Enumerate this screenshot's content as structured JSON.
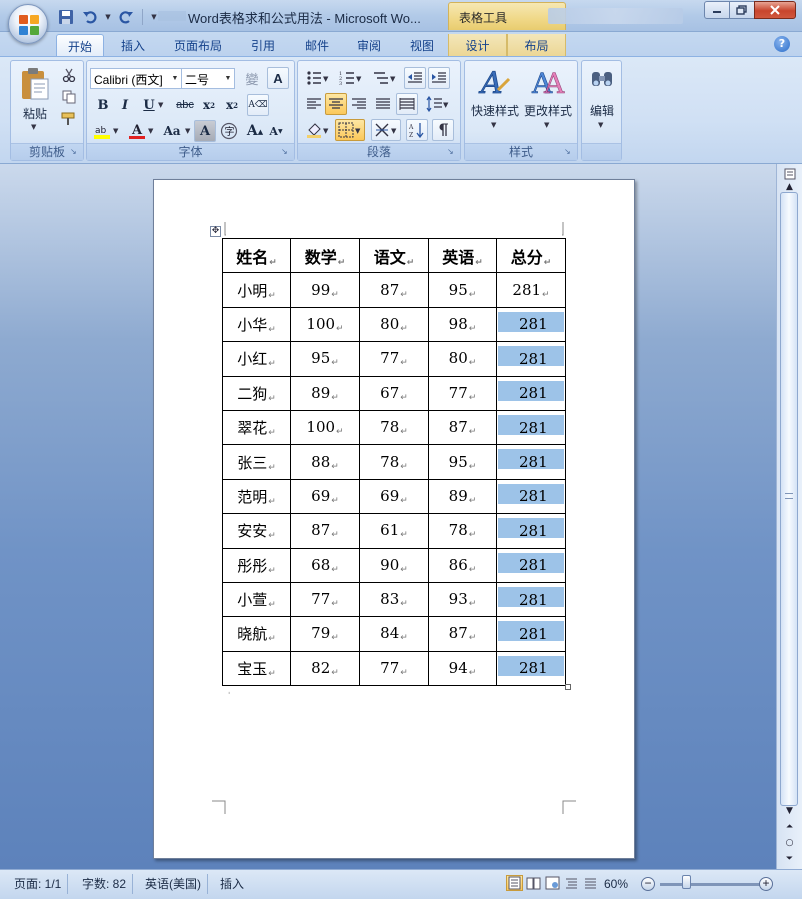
{
  "window": {
    "title": "Word表格求和公式用法 - Microsoft Wo...",
    "context_tab_group": "表格工具"
  },
  "tabs": [
    "开始",
    "插入",
    "页面布局",
    "引用",
    "邮件",
    "审阅",
    "视图",
    "设计",
    "布局"
  ],
  "ribbon": {
    "clipboard": {
      "label": "剪贴板",
      "paste": "粘贴"
    },
    "font": {
      "label": "字体",
      "font_name": "Calibri (西文]",
      "font_size": "二号",
      "wen_glyph": "變",
      "a_glyph": "A"
    },
    "paragraph": {
      "label": "段落"
    },
    "styles": {
      "label": "样式",
      "quick_styles": "快速样式",
      "change_styles": "更改样式"
    },
    "editing": {
      "label": "编辑"
    }
  },
  "table": {
    "headers": [
      "姓名",
      "数学",
      "语文",
      "英语",
      "总分"
    ],
    "rows": [
      [
        "小明",
        "99",
        "87",
        "95",
        "281"
      ],
      [
        "小华",
        "100",
        "80",
        "98",
        "281"
      ],
      [
        "小红",
        "95",
        "77",
        "80",
        "281"
      ],
      [
        "二狗",
        "89",
        "67",
        "77",
        "281"
      ],
      [
        "翠花",
        "100",
        "78",
        "87",
        "281"
      ],
      [
        "张三",
        "88",
        "78",
        "95",
        "281"
      ],
      [
        "范明",
        "69",
        "69",
        "89",
        "281"
      ],
      [
        "安安",
        "87",
        "61",
        "78",
        "281"
      ],
      [
        "彤彤",
        "68",
        "90",
        "86",
        "281"
      ],
      [
        "小萱",
        "77",
        "83",
        "93",
        "281"
      ],
      [
        "晓航",
        "79",
        "84",
        "87",
        "281"
      ],
      [
        "宝玉",
        "82",
        "77",
        "94",
        "281"
      ]
    ],
    "highlight_color": "#9dc3e8"
  },
  "statusbar": {
    "page": "页面: 1/1",
    "words": "字数: 82",
    "language": "英语(美国)",
    "mode": "插入",
    "zoom": "60%"
  },
  "colors": {
    "ribbon_text": "#15428b",
    "active_view": "#fbc85a"
  }
}
